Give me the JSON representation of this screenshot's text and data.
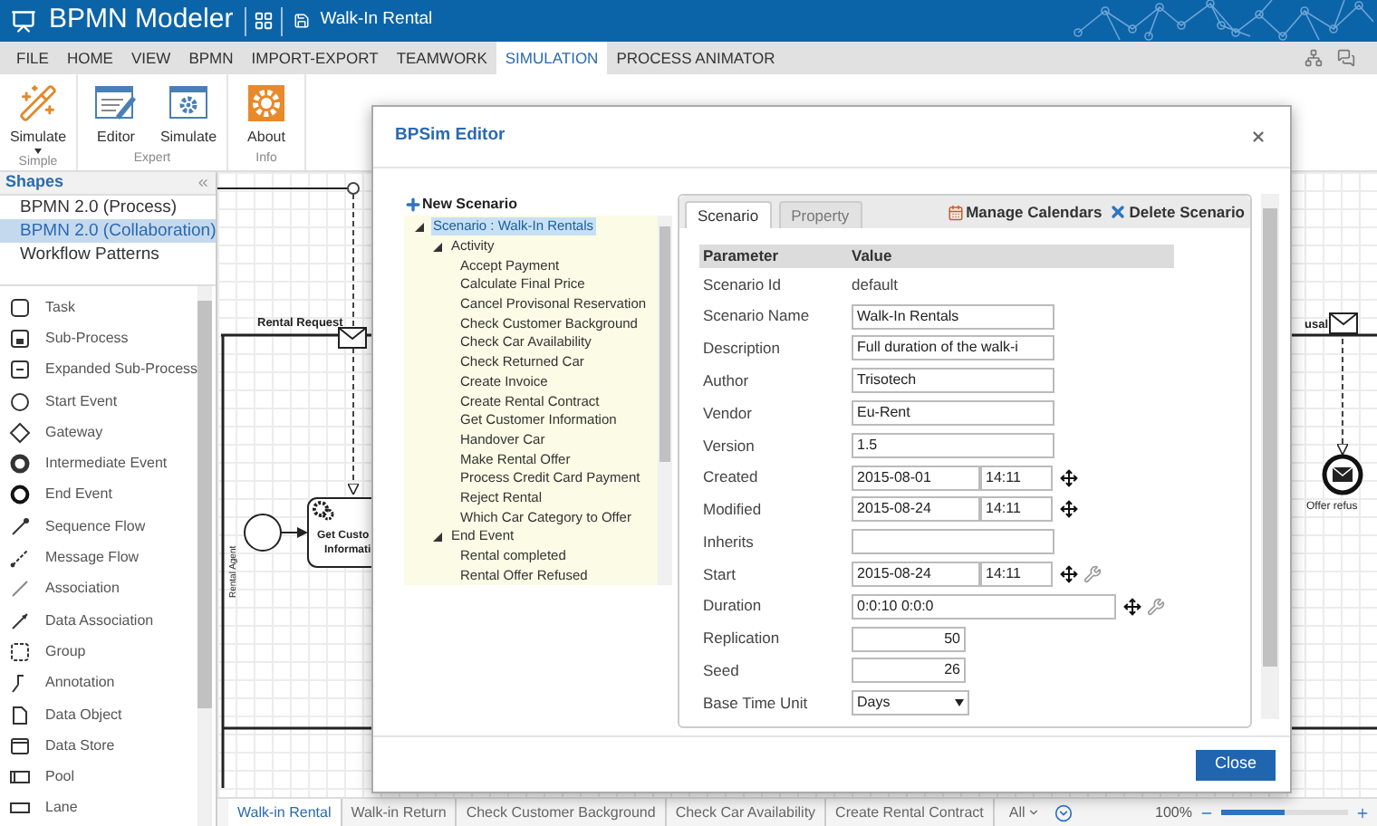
{
  "header": {
    "app_title": "BPMN Modeler",
    "document_title": "Walk-In Rental"
  },
  "menu": [
    {
      "label": "FILE",
      "selected": false
    },
    {
      "label": "HOME",
      "selected": false
    },
    {
      "label": "VIEW",
      "selected": false
    },
    {
      "label": "BPMN",
      "selected": false
    },
    {
      "label": "IMPORT-EXPORT",
      "selected": false
    },
    {
      "label": "TEAMWORK",
      "selected": false
    },
    {
      "label": "SIMULATION",
      "selected": true
    },
    {
      "label": "PROCESS ANIMATOR",
      "selected": false
    }
  ],
  "ribbon": [
    {
      "label": "Simple",
      "buttons": [
        {
          "label": "Simulate",
          "kind": "wand",
          "dropdown": true
        }
      ]
    },
    {
      "label": "Expert",
      "buttons": [
        {
          "label": "Editor",
          "kind": "editor",
          "dropdown": false
        },
        {
          "label": "Simulate",
          "kind": "simulate",
          "dropdown": false
        }
      ]
    },
    {
      "label": "Info",
      "buttons": [
        {
          "label": "About",
          "kind": "about",
          "dropdown": false
        }
      ]
    }
  ],
  "shapes_panel": {
    "title": "Shapes",
    "palettes": [
      {
        "label": "BPMN 2.0 (Process)",
        "selected": false
      },
      {
        "label": "BPMN 2.0 (Collaboration)",
        "selected": true
      },
      {
        "label": "Workflow Patterns",
        "selected": false
      }
    ],
    "items": [
      {
        "label": "Task",
        "kind": "task"
      },
      {
        "label": "Sub-Process",
        "kind": "sub-process"
      },
      {
        "label": "Expanded Sub-Process",
        "kind": "expanded-sub-process"
      },
      {
        "label": "Start Event",
        "kind": "start-event"
      },
      {
        "label": "Gateway",
        "kind": "gateway"
      },
      {
        "label": "Intermediate Event",
        "kind": "intermediate-event"
      },
      {
        "label": "End Event",
        "kind": "end-event"
      },
      {
        "label": "Sequence Flow",
        "kind": "sequence-flow"
      },
      {
        "label": "Message Flow",
        "kind": "message-flow"
      },
      {
        "label": "Association",
        "kind": "association"
      },
      {
        "label": "Data Association",
        "kind": "data-association"
      },
      {
        "label": "Group",
        "kind": "group"
      },
      {
        "label": "Annotation",
        "kind": "annotation"
      },
      {
        "label": "Data Object",
        "kind": "data-object"
      },
      {
        "label": "Data Store",
        "kind": "data-store"
      },
      {
        "label": "Pool",
        "kind": "pool"
      },
      {
        "label": "Lane",
        "kind": "lane"
      }
    ]
  },
  "diagram": {
    "message_label": "Rental Request",
    "lane_label": "Rental Agent",
    "task_lines": [
      "Get Custo",
      "Informati"
    ],
    "right_message_label": "usal",
    "end_event_label": "Offer refus"
  },
  "diagram_tabs": [
    {
      "label": "Walk-in Rental",
      "selected": true
    },
    {
      "label": "Walk-in Return",
      "selected": false
    },
    {
      "label": "Check Customer Background",
      "selected": false
    },
    {
      "label": "Check Car Availability",
      "selected": false
    },
    {
      "label": "Create Rental Contract",
      "selected": false
    }
  ],
  "tab_filter": "All",
  "zoom": {
    "label": "100%",
    "level": 0.5
  },
  "dialog": {
    "title": "BPSim Editor",
    "new_scenario": "New Scenario",
    "tree": [
      {
        "label": "Scenario : Walk-In Rentals",
        "selected": true,
        "expanded": true,
        "children": [
          {
            "label": "Activity",
            "selected": false,
            "expanded": true,
            "children": [
              {
                "label": "Accept Payment",
                "selected": false
              },
              {
                "label": "Calculate Final Price",
                "selected": false
              },
              {
                "label": "Cancel Provisonal Reservation",
                "selected": false
              },
              {
                "label": "Check Customer Background",
                "selected": false
              },
              {
                "label": "Check Car Availability",
                "selected": false
              },
              {
                "label": "Check Returned Car",
                "selected": false
              },
              {
                "label": "Create Invoice",
                "selected": false
              },
              {
                "label": "Create Rental Contract",
                "selected": false
              },
              {
                "label": "Get Customer Information",
                "selected": false
              },
              {
                "label": "Handover Car",
                "selected": false
              },
              {
                "label": "Make Rental Offer",
                "selected": false
              },
              {
                "label": "Process Credit Card Payment",
                "selected": false
              },
              {
                "label": "Reject Rental",
                "selected": false
              },
              {
                "label": "Which Car Category to Offer",
                "selected": false
              }
            ]
          },
          {
            "label": "End Event",
            "selected": false,
            "expanded": true,
            "children": [
              {
                "label": "Rental completed",
                "selected": false
              },
              {
                "label": "Rental Offer Refused",
                "selected": false
              }
            ]
          }
        ]
      }
    ],
    "tabs": [
      {
        "label": "Scenario",
        "selected": true
      },
      {
        "label": "Property",
        "selected": false
      }
    ],
    "actions": [
      {
        "label": "Manage Calendars",
        "kind": "calendar"
      },
      {
        "label": "Delete Scenario",
        "kind": "delete"
      }
    ],
    "columns": [
      "Parameter",
      "Value"
    ],
    "rows": [
      {
        "label": "Scenario Id",
        "kind": "text",
        "value": "default"
      },
      {
        "label": "Scenario Name",
        "kind": "input",
        "value": "Walk-In Rentals"
      },
      {
        "label": "Description",
        "kind": "input",
        "value": "Full duration of the walk-i"
      },
      {
        "label": "Author",
        "kind": "input",
        "value": "Trisotech"
      },
      {
        "label": "Vendor",
        "kind": "input",
        "value": "Eu-Rent"
      },
      {
        "label": "Version",
        "kind": "input",
        "value": "1.5"
      },
      {
        "label": "Created",
        "kind": "datetime",
        "date": "2015-08-01",
        "time": "14:11",
        "configurable": false
      },
      {
        "label": "Modified",
        "kind": "datetime",
        "date": "2015-08-24",
        "time": "14:11",
        "configurable": false
      },
      {
        "label": "Inherits",
        "kind": "input"
      },
      {
        "label": "Start",
        "kind": "datetime",
        "date": "2015-08-24",
        "time": "14:11",
        "configurable": true
      },
      {
        "label": "Duration",
        "kind": "duration",
        "value": "0:0:10  0:0:0",
        "configurable": true
      },
      {
        "label": "Replication",
        "kind": "number",
        "value": "50"
      },
      {
        "label": "Seed",
        "kind": "number",
        "value": "26"
      },
      {
        "label": "Base Time Unit",
        "kind": "select",
        "value": "Days"
      }
    ],
    "close_button": "Close"
  }
}
